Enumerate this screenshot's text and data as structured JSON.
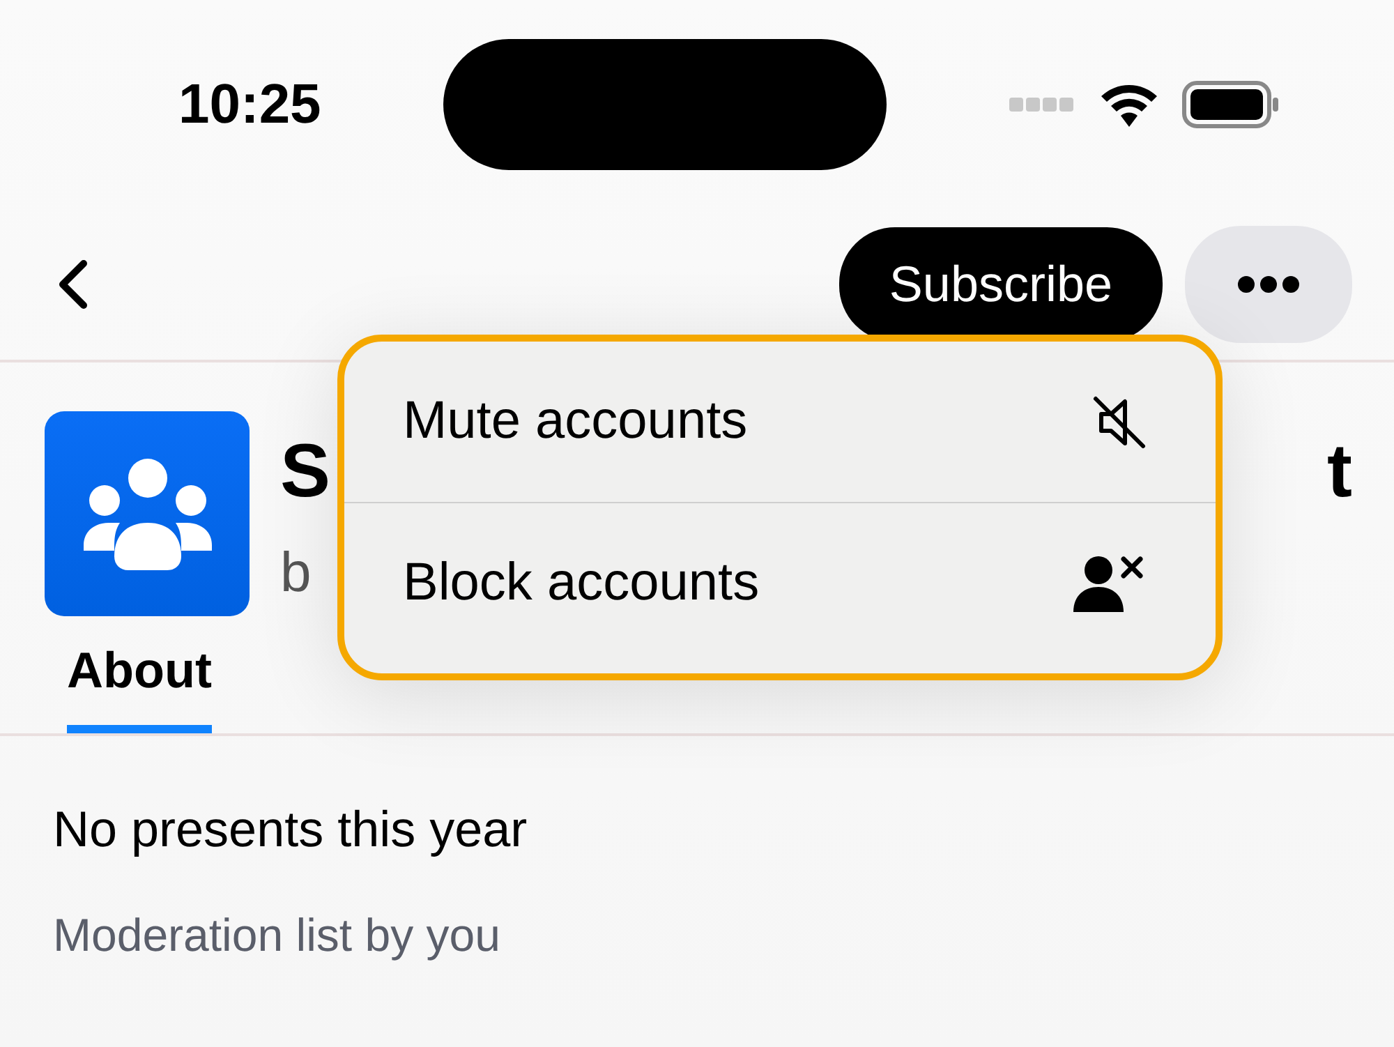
{
  "status_bar": {
    "time": "10:25"
  },
  "nav": {
    "subscribe_label": "Subscribe"
  },
  "header": {
    "title_start": "S",
    "title_end": "t",
    "byline": "b"
  },
  "tabs": [
    {
      "label": "About",
      "selected": true
    }
  ],
  "description": "No presents this year",
  "subtitle": "Moderation list by you",
  "menu": {
    "highlighted": true,
    "items": [
      {
        "label": "Mute accounts",
        "kind": "mute"
      },
      {
        "label": "Block accounts",
        "kind": "block"
      }
    ]
  }
}
